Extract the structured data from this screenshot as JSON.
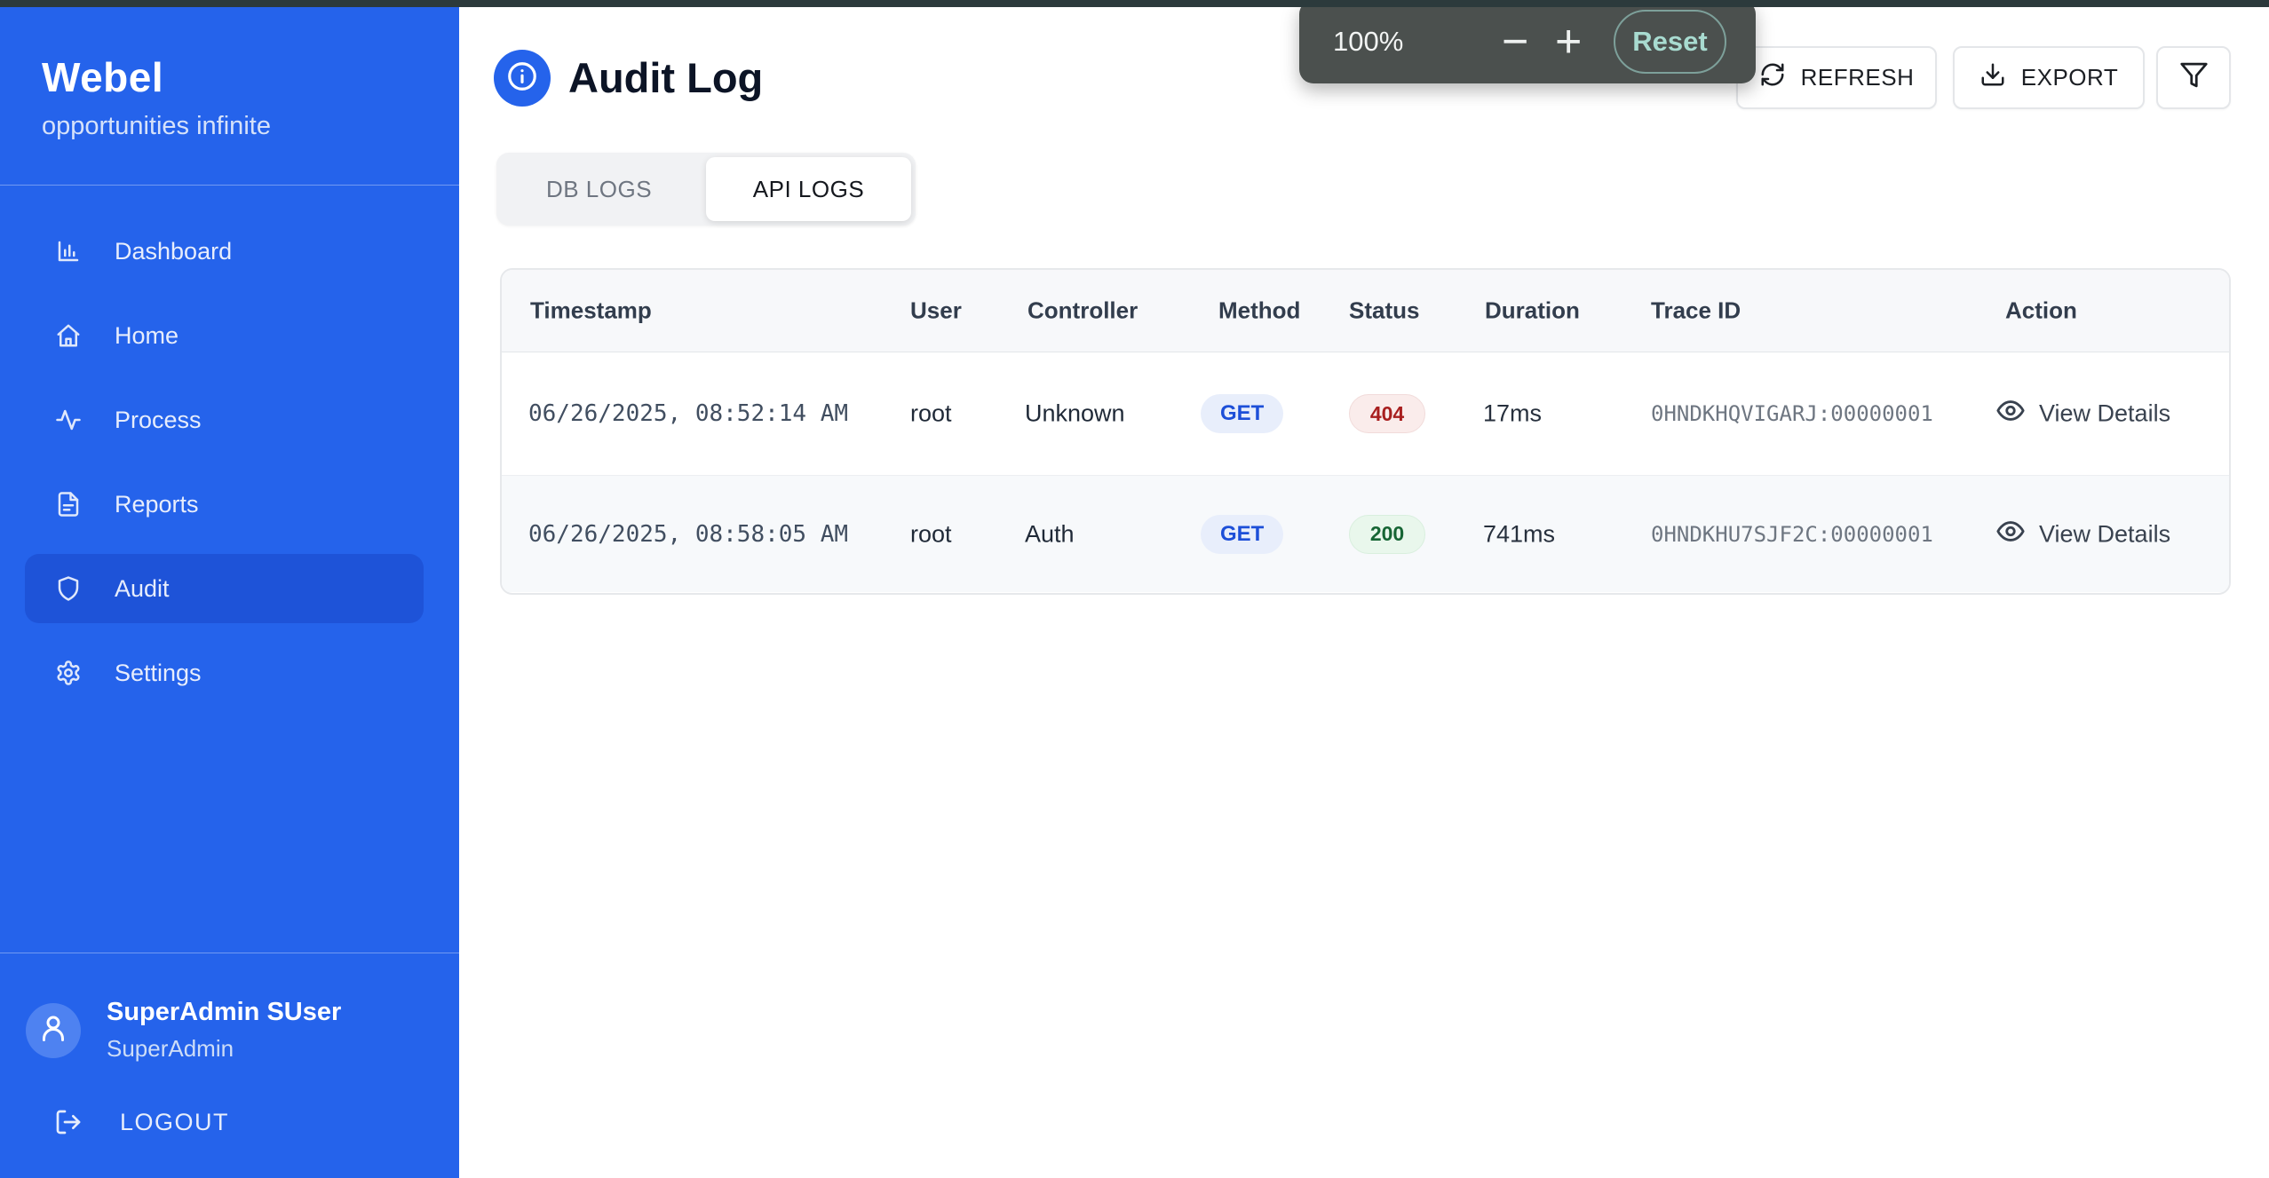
{
  "colors": {
    "brand_blue": "#2563eb",
    "sidebar_active_item": "#1e53d8",
    "top_strip": "#2c3a3c",
    "zoom_overlay_bg": "#4b504e",
    "zoom_reset_text": "#a8dbd0",
    "method_get_text": "#1d4fd8",
    "status_error_text": "#a81f1f",
    "status_success_text": "#166534"
  },
  "zoom_overlay": {
    "level": "100%",
    "minus_label": "−",
    "plus_label": "+",
    "reset_label": "Reset"
  },
  "sidebar": {
    "brand": {
      "name": "Webel",
      "tagline": "opportunities infinite"
    },
    "items": [
      {
        "label": "Dashboard",
        "icon": "bar-chart-icon",
        "active": false
      },
      {
        "label": "Home",
        "icon": "home-icon",
        "active": false
      },
      {
        "label": "Process",
        "icon": "activity-icon",
        "active": false
      },
      {
        "label": "Reports",
        "icon": "document-icon",
        "active": false
      },
      {
        "label": "Audit",
        "icon": "shield-icon",
        "active": true
      },
      {
        "label": "Settings",
        "icon": "gear-icon",
        "active": false
      }
    ],
    "user": {
      "name": "SuperAdmin SUser",
      "role": "SuperAdmin"
    },
    "logout_label": "LOGOUT"
  },
  "header": {
    "title": "Audit Log",
    "refresh_label": "REFRESH",
    "export_label": "EXPORT"
  },
  "tabs": [
    {
      "label": "DB LOGS",
      "active": false
    },
    {
      "label": "API LOGS",
      "active": true
    }
  ],
  "table": {
    "columns": [
      "Timestamp",
      "User",
      "Controller",
      "Method",
      "Status",
      "Duration",
      "Trace ID",
      "Action"
    ],
    "rows": [
      {
        "timestamp": "06/26/2025, 08:52:14 AM",
        "user": "root",
        "controller": "Unknown",
        "method": "GET",
        "status": "404",
        "status_type": "error",
        "duration": "17ms",
        "trace_id": "0HNDKHQVIGARJ:00000001",
        "action_label": "View Details"
      },
      {
        "timestamp": "06/26/2025, 08:58:05 AM",
        "user": "root",
        "controller": "Auth",
        "method": "GET",
        "status": "200",
        "status_type": "success",
        "duration": "741ms",
        "trace_id": "0HNDKHU7SJF2C:00000001",
        "action_label": "View Details"
      }
    ]
  }
}
